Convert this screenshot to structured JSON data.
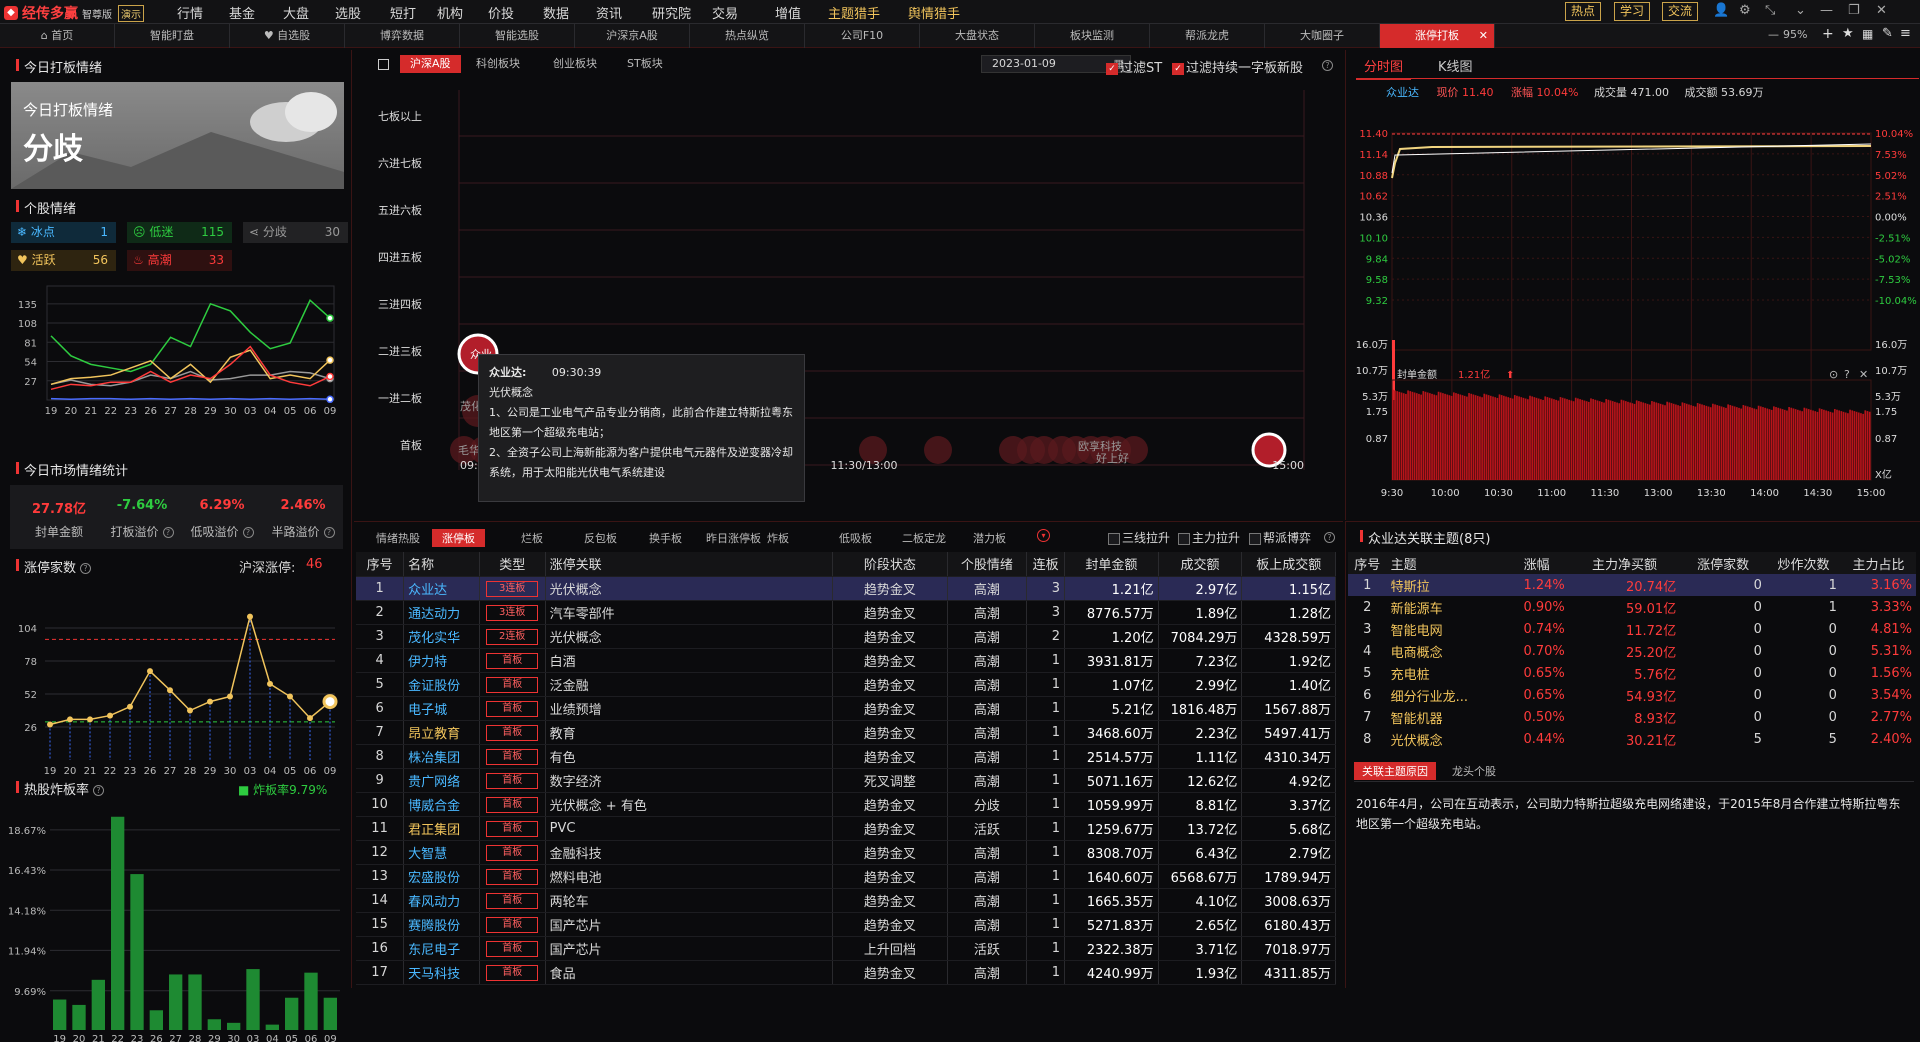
{
  "app": {
    "brand": "经传多赢",
    "edition": "智尊版",
    "demo": "演示"
  },
  "menu": [
    "行情",
    "基金",
    "大盘",
    "选股",
    "短打",
    "机构",
    "价投",
    "数据",
    "资讯",
    "研究院",
    "交易",
    "增值",
    "主题猎手",
    "舆情猎手"
  ],
  "top_buttons": [
    "热点",
    "学习",
    "交流"
  ],
  "zoom": "95%",
  "tabs": [
    "首页",
    "智能盯盘",
    "自选股",
    "博弈数据",
    "智能选股",
    "沪深京A股",
    "热点纵览",
    "公司F10",
    "大盘状态",
    "板块监测",
    "帮派龙虎",
    "大咖圈子",
    "涨停打板"
  ],
  "left": {
    "title_today": "今日打板情绪",
    "banner_title": "今日打板情绪",
    "banner_mood": "分歧",
    "title_stock_mood": "个股情绪",
    "chips": [
      {
        "name": "冰点",
        "value": "1",
        "color": "#4ab8ff"
      },
      {
        "name": "低迷",
        "value": "115",
        "color": "#2ecc40"
      },
      {
        "name": "分歧",
        "value": "30",
        "color": "#999999"
      },
      {
        "name": "活跃",
        "value": "56",
        "color": "#f1c45c"
      },
      {
        "name": "高潮",
        "value": "33",
        "color": "#ff3b3b"
      }
    ],
    "mood_y_ticks": [
      "135",
      "108",
      "81",
      "54",
      "27"
    ],
    "dates": [
      "19",
      "20",
      "21",
      "22",
      "23",
      "26",
      "27",
      "28",
      "29",
      "30",
      "03",
      "04",
      "05",
      "06",
      "09"
    ],
    "title_market_stats": "今日市场情绪统计",
    "stats": [
      {
        "value": "27.78亿",
        "label": "封单金额",
        "color": "#ff3b3b"
      },
      {
        "value": "-7.64%",
        "label": "打板溢价",
        "color": "#2ecc40"
      },
      {
        "value": "6.29%",
        "label": "低吸溢价",
        "color": "#ff3b3b"
      },
      {
        "value": "2.46%",
        "label": "半路溢价",
        "color": "#ff3b3b"
      }
    ],
    "title_limit_count": "涨停家数",
    "limit_label": "沪深涨停:",
    "limit_value": "46",
    "limit_y_ticks": [
      "104",
      "78",
      "52",
      "26"
    ],
    "title_bomb": "热股炸板率",
    "bomb_legend": "炸板率9.79%",
    "bomb_y_ticks": [
      "18.67%",
      "16.43%",
      "14.18%",
      "11.94%",
      "9.69%"
    ]
  },
  "center": {
    "tabs": [
      "沪深A股",
      "科创板块",
      "创业板块",
      "ST板块"
    ],
    "date": "2023-01-09",
    "filter1": "过滤ST",
    "filter2": "过滤持续一字板新股",
    "levels": [
      "七板以上",
      "六进七板",
      "五进六板",
      "四进五板",
      "三进四板",
      "二进三板",
      "一进二板",
      "首板"
    ],
    "time_start": "09:25",
    "time_mid": "11:30/13:00",
    "time_end": "15:00",
    "bubble_labels": [
      "众业",
      "茂化实华",
      "毛华五",
      "欧享科技",
      "好上好"
    ],
    "tooltip": {
      "name": "众业达:",
      "time": "09:30:39",
      "concept": "光伏概念",
      "line1": "1、公司是工业电气产品专业分销商，此前合作建立特斯拉粤东地区第一个超级充电站；",
      "line2": "2、全资子公司上海新能源为客户提供电气元器件及逆变器冷却系统，用于太阳能光伏电气系统建设"
    },
    "bottom_tabs": [
      "情绪热股",
      "涨停板",
      "烂板",
      "反包板",
      "换手板",
      "昨日涨停板",
      "炸板",
      "低吸板",
      "二板定龙",
      "潜力板"
    ],
    "bottom_filters": [
      "三线拉升",
      "主力拉升",
      "帮派博弈"
    ],
    "table_headers": [
      "序号",
      "名称",
      "类型",
      "涨停关联",
      "阶段状态",
      "个股情绪",
      "连板",
      "封单金额",
      "成交额",
      "板上成交额"
    ],
    "rows": [
      [
        "1",
        "众业达",
        "3连板",
        "光伏概念",
        "趋势金叉",
        "高潮",
        "3",
        "1.21亿",
        "2.97亿",
        "1.15亿"
      ],
      [
        "2",
        "通达动力",
        "3连板",
        "汽车零部件",
        "趋势金叉",
        "高潮",
        "3",
        "8776.57万",
        "1.89亿",
        "1.28亿"
      ],
      [
        "3",
        "茂化实华",
        "2连板",
        "光伏概念",
        "趋势金叉",
        "高潮",
        "2",
        "1.20亿",
        "7084.29万",
        "4328.59万"
      ],
      [
        "4",
        "伊力特",
        "首板",
        "白酒",
        "趋势金叉",
        "高潮",
        "1",
        "3931.81万",
        "7.23亿",
        "1.92亿"
      ],
      [
        "5",
        "金证股份",
        "首板",
        "泛金融",
        "趋势金叉",
        "高潮",
        "1",
        "1.07亿",
        "2.99亿",
        "1.40亿"
      ],
      [
        "6",
        "电子城",
        "首板",
        "业绩预增",
        "趋势金叉",
        "高潮",
        "1",
        "5.21亿",
        "1816.48万",
        "1567.88万"
      ],
      [
        "7",
        "昂立教育",
        "首板",
        "教育",
        "趋势金叉",
        "高潮",
        "1",
        "3468.60万",
        "2.23亿",
        "5497.41万"
      ],
      [
        "8",
        "株冶集团",
        "首板",
        "有色",
        "趋势金叉",
        "高潮",
        "1",
        "2514.57万",
        "1.11亿",
        "4310.34万"
      ],
      [
        "9",
        "贵广网络",
        "首板",
        "数字经济",
        "死叉调整",
        "高潮",
        "1",
        "5071.16万",
        "12.62亿",
        "4.92亿"
      ],
      [
        "10",
        "博威合金",
        "首板",
        "光伏概念 + 有色",
        "趋势金叉",
        "分歧",
        "1",
        "1059.99万",
        "8.81亿",
        "3.37亿"
      ],
      [
        "11",
        "君正集团",
        "首板",
        "PVC",
        "趋势金叉",
        "活跃",
        "1",
        "1259.67万",
        "13.72亿",
        "5.68亿"
      ],
      [
        "12",
        "大智慧",
        "首板",
        "金融科技",
        "趋势金叉",
        "高潮",
        "1",
        "8308.70万",
        "6.43亿",
        "2.79亿"
      ],
      [
        "13",
        "宏盛股份",
        "首板",
        "燃料电池",
        "趋势金叉",
        "高潮",
        "1",
        "1640.60万",
        "6568.67万",
        "1789.94万"
      ],
      [
        "14",
        "春风动力",
        "首板",
        "两轮车",
        "趋势金叉",
        "高潮",
        "1",
        "1665.35万",
        "4.10亿",
        "3008.63万"
      ],
      [
        "15",
        "赛腾股份",
        "首板",
        "国产芯片",
        "趋势金叉",
        "高潮",
        "1",
        "5271.83万",
        "2.65亿",
        "6180.43万"
      ],
      [
        "16",
        "东尼电子",
        "首板",
        "国产芯片",
        "上升回档",
        "活跃",
        "1",
        "2322.38万",
        "3.71亿",
        "7018.97万"
      ],
      [
        "17",
        "天马科技",
        "首板",
        "食品",
        "趋势金叉",
        "高潮",
        "1",
        "4240.99万",
        "1.93亿",
        "4311.85万"
      ]
    ],
    "name_colors": [
      "#4ab8ff",
      "#4ab8ff",
      "#4ab8ff",
      "#4ab8ff",
      "#4ab8ff",
      "#4ab8ff",
      "#f1c45c",
      "#4ab8ff",
      "#4ab8ff",
      "#4ab8ff",
      "#f1c45c",
      "#4ab8ff",
      "#4ab8ff",
      "#4ab8ff",
      "#4ab8ff",
      "#4ab8ff",
      "#4ab8ff"
    ]
  },
  "right": {
    "tabs": [
      "分时图",
      "K线图"
    ],
    "quote": {
      "name": "众业达",
      "price_label": "现价",
      "price": "11.40",
      "chg_label": "涨幅",
      "chg": "10.04%",
      "vol_label": "成交量",
      "vol": "471.00",
      "amt_label": "成交额",
      "amt": "53.69万"
    },
    "price_ticks_left": [
      "11.40",
      "11.14",
      "10.88",
      "10.62",
      "10.36",
      "10.10",
      "9.84",
      "9.58",
      "9.32"
    ],
    "price_ticks_right": [
      "10.04%",
      "7.53%",
      "5.02%",
      "2.51%",
      "0.00%",
      "-2.51%",
      "-5.02%",
      "-7.53%",
      "-10.04%"
    ],
    "vol_ticks": [
      "16.0万",
      "10.7万",
      "5.3万"
    ],
    "seal_label": "封单金额",
    "seal_value": "1.21亿",
    "seal_ticks": [
      "1.75",
      "0.87"
    ],
    "seal_unit": "X亿",
    "time_ticks": [
      "9:30",
      "10:00",
      "10:30",
      "11:00",
      "11:30",
      "13:00",
      "13:30",
      "14:00",
      "14:30",
      "15:00"
    ],
    "theme_title": "众业达关联主题(8只)",
    "theme_headers": [
      "序号",
      "主题",
      "涨幅",
      "主力净买额",
      "涨停家数",
      "炒作次数",
      "主力占比"
    ],
    "theme_rows": [
      [
        "1",
        "特斯拉",
        "1.24%",
        "20.74亿",
        "0",
        "1",
        "3.16%"
      ],
      [
        "2",
        "新能源车",
        "0.90%",
        "59.01亿",
        "0",
        "1",
        "3.33%"
      ],
      [
        "3",
        "智能电网",
        "0.74%",
        "11.72亿",
        "0",
        "0",
        "4.81%"
      ],
      [
        "4",
        "电商概念",
        "0.70%",
        "25.20亿",
        "0",
        "0",
        "5.31%"
      ],
      [
        "5",
        "充电桩",
        "0.65%",
        "5.76亿",
        "0",
        "0",
        "1.56%"
      ],
      [
        "6",
        "细分行业龙...",
        "0.65%",
        "54.93亿",
        "0",
        "0",
        "3.54%"
      ],
      [
        "7",
        "智能机器",
        "0.50%",
        "8.93亿",
        "0",
        "0",
        "2.77%"
      ],
      [
        "8",
        "光伏概念",
        "0.44%",
        "30.21亿",
        "5",
        "5",
        "2.40%"
      ]
    ],
    "reason_tabs": [
      "关联主题原因",
      "龙头个股"
    ],
    "reason_text": "2016年4月，公司在互动表示，公司助力特斯拉超级充电网络建设，于2015年8月合作建立特斯拉粤东地区第一个超级充电站。"
  },
  "chart_data": [
    {
      "type": "line",
      "title": "个股情绪",
      "categories": [
        "19",
        "20",
        "21",
        "22",
        "23",
        "26",
        "27",
        "28",
        "29",
        "30",
        "03",
        "04",
        "05",
        "06",
        "09"
      ],
      "ylim": [
        0,
        160
      ],
      "series": [
        {
          "name": "低迷",
          "color": "#2ecc40",
          "values": [
            90,
            62,
            50,
            45,
            40,
            50,
            88,
            75,
            135,
            125,
            95,
            72,
            80,
            140,
            115
          ]
        },
        {
          "name": "分歧",
          "color": "#999999",
          "values": [
            22,
            28,
            22,
            20,
            25,
            35,
            30,
            40,
            28,
            30,
            35,
            35,
            40,
            38,
            30
          ]
        },
        {
          "name": "活跃",
          "color": "#f1c45c",
          "values": [
            22,
            30,
            32,
            35,
            45,
            55,
            30,
            50,
            25,
            60,
            70,
            30,
            35,
            30,
            56
          ]
        },
        {
          "name": "高潮",
          "color": "#ff3b3b",
          "values": [
            15,
            22,
            20,
            25,
            25,
            40,
            25,
            35,
            30,
            50,
            75,
            35,
            25,
            20,
            33
          ]
        },
        {
          "name": "冰点",
          "color": "#4a6cff",
          "values": [
            2,
            1,
            2,
            2,
            1,
            2,
            1,
            2,
            1,
            2,
            1,
            2,
            1,
            2,
            1
          ]
        }
      ]
    },
    {
      "type": "line",
      "title": "涨停家数",
      "categories": [
        "19",
        "20",
        "21",
        "22",
        "23",
        "26",
        "27",
        "28",
        "29",
        "30",
        "03",
        "04",
        "05",
        "06",
        "09"
      ],
      "ylim": [
        0,
        130
      ],
      "reference": 95,
      "series": [
        {
          "name": "涨停家数",
          "color": "#f1c45c",
          "values": [
            28,
            32,
            32,
            35,
            42,
            70,
            55,
            39,
            46,
            50,
            113,
            60,
            50,
            33,
            46
          ]
        }
      ]
    },
    {
      "type": "bar",
      "title": "热股炸板率",
      "categories": [
        "19",
        "20",
        "21",
        "22",
        "23",
        "26",
        "27",
        "28",
        "29",
        "30",
        "03",
        "04",
        "05",
        "06",
        "09"
      ],
      "ylim": [
        7.5,
        20
      ],
      "series": [
        {
          "name": "炸板率",
          "color": "#1e8a32",
          "values": [
            9.2,
            8.9,
            10.3,
            19.4,
            16.2,
            8.6,
            10.6,
            10.6,
            8.1,
            7.9,
            10.9,
            7.8,
            9.3,
            10.7,
            9.3
          ]
        }
      ]
    }
  ]
}
